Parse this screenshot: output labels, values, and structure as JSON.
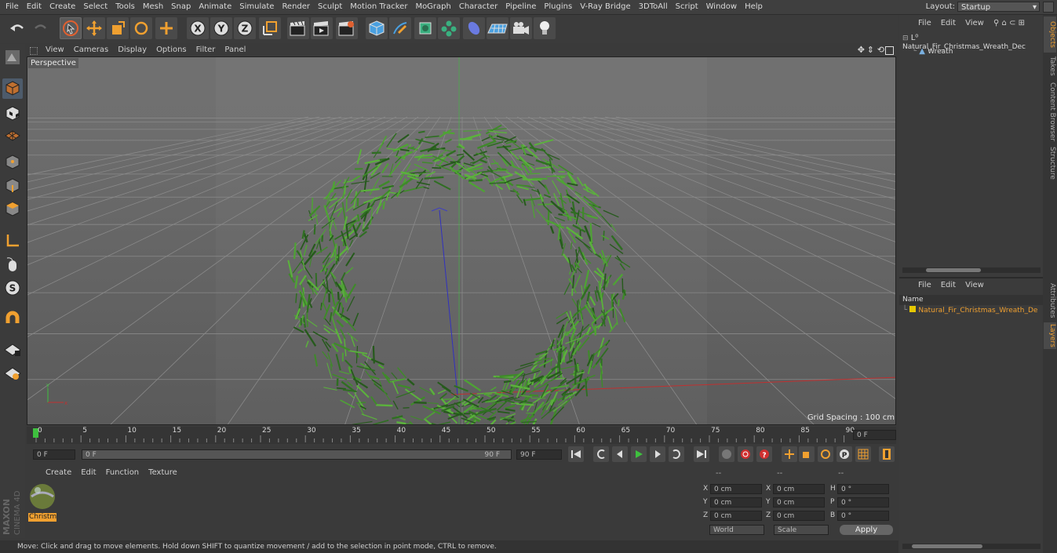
{
  "menubar": {
    "items": [
      "File",
      "Edit",
      "Create",
      "Select",
      "Tools",
      "Mesh",
      "Snap",
      "Animate",
      "Simulate",
      "Render",
      "Sculpt",
      "Motion Tracker",
      "MoGraph",
      "Character",
      "Pipeline",
      "Plugins",
      "V-Ray Bridge",
      "3DToAll",
      "Script",
      "Window",
      "Help"
    ],
    "layout_label": "Layout:",
    "layout_value": "Startup"
  },
  "viewport": {
    "menu": [
      "View",
      "Cameras",
      "Display",
      "Options",
      "Filter",
      "Panel"
    ],
    "label": "Perspective",
    "grid_spacing": "Grid Spacing : 100 cm"
  },
  "timeline": {
    "ticks": [
      "0",
      "5",
      "10",
      "15",
      "20",
      "25",
      "30",
      "35",
      "40",
      "45",
      "50",
      "55",
      "60",
      "65",
      "70",
      "75",
      "80",
      "85",
      "90"
    ],
    "end_frame": "0 F",
    "start_field": "0 F",
    "range_start": "0 F",
    "range_end": "90 F",
    "max_field": "90 F"
  },
  "material_panel": {
    "menu": [
      "Create",
      "Edit",
      "Function",
      "Texture"
    ],
    "material_name": "Christm"
  },
  "coords": {
    "headers": [
      "--",
      "--",
      "--"
    ],
    "rows": [
      {
        "a": "X",
        "av": "0 cm",
        "b": "X",
        "bv": "0 cm",
        "c": "H",
        "cv": "0 °"
      },
      {
        "a": "Y",
        "av": "0 cm",
        "b": "Y",
        "bv": "0 cm",
        "c": "P",
        "cv": "0 °"
      },
      {
        "a": "Z",
        "av": "0 cm",
        "b": "Z",
        "bv": "0 cm",
        "c": "B",
        "cv": "0 °"
      }
    ],
    "world": "World",
    "scale": "Scale",
    "apply": "Apply"
  },
  "objects_panel": {
    "menu": [
      "File",
      "Edit",
      "View"
    ],
    "root": "Natural_Fir_Christmas_Wreath_Dec",
    "child": "Wreath"
  },
  "layers_panel": {
    "menu": [
      "File",
      "Edit",
      "View"
    ],
    "column": "Name",
    "layer": "Natural_Fir_Christmas_Wreath_De",
    "layer_color": "#e6c800"
  },
  "tabs": [
    "Objects",
    "Takes",
    "Content Browser",
    "Structure",
    "Attributes",
    "Layers"
  ],
  "status": "Move: Click and drag to move elements. Hold down SHIFT to quantize movement / add to the selection in point mode, CTRL to remove.",
  "brand": {
    "a": "MAXON",
    "b": "CINEMA 4D"
  },
  "colors": {
    "accent": "#f0a030",
    "wreath": "#3f8a2a"
  }
}
